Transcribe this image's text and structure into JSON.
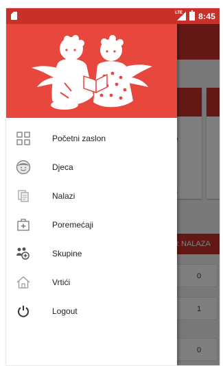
{
  "status_bar": {
    "network_label": "LTE",
    "time": "8:45"
  },
  "background": {
    "card_text_1": "e",
    "card_text_2": "ć",
    "section_button": "R NALAZA",
    "values": [
      "0",
      "1",
      "0"
    ]
  },
  "drawer": {
    "menu": [
      {
        "label": "Početni zaslon",
        "icon": "grid-icon"
      },
      {
        "label": "Djeca",
        "icon": "child-face-icon"
      },
      {
        "label": "Nalazi",
        "icon": "documents-icon"
      },
      {
        "label": "Poremećaji",
        "icon": "first-aid-icon"
      },
      {
        "label": "Skupine",
        "icon": "group-icon"
      },
      {
        "label": "Vrtići",
        "icon": "house-icon"
      },
      {
        "label": "Logout",
        "icon": "power-icon"
      }
    ]
  },
  "colors": {
    "primary": "#c8312a",
    "header": "#e8473d"
  }
}
